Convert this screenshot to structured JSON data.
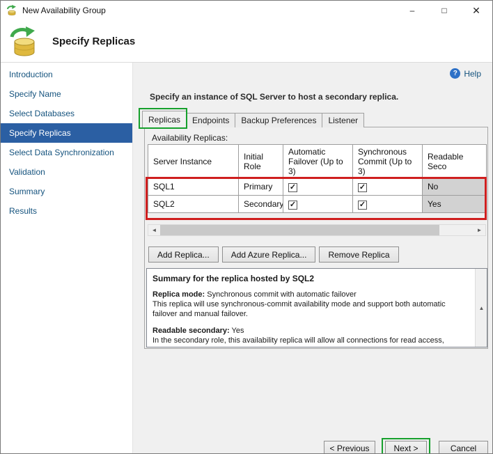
{
  "window": {
    "title": "New Availability Group"
  },
  "icons": {
    "minimize": "–",
    "maximize": "□",
    "close": "✕",
    "help": "?",
    "check": "✓",
    "scroll_left": "◄",
    "scroll_right": "►",
    "scroll_up": "▲",
    "scroll_down": "▼"
  },
  "header": {
    "title": "Specify Replicas"
  },
  "sidebar": {
    "items": [
      {
        "label": "Introduction",
        "selected": false
      },
      {
        "label": "Specify Name",
        "selected": false
      },
      {
        "label": "Select Databases",
        "selected": false
      },
      {
        "label": "Specify Replicas",
        "selected": true
      },
      {
        "label": "Select Data Synchronization",
        "selected": false
      },
      {
        "label": "Validation",
        "selected": false
      },
      {
        "label": "Summary",
        "selected": false
      },
      {
        "label": "Results",
        "selected": false
      }
    ]
  },
  "main": {
    "help_label": "Help",
    "instruction": "Specify an instance of SQL Server to host a secondary replica.",
    "tabs": [
      {
        "label": "Replicas",
        "active": true
      },
      {
        "label": "Endpoints",
        "active": false
      },
      {
        "label": "Backup Preferences",
        "active": false
      },
      {
        "label": "Listener",
        "active": false
      }
    ],
    "availability_label": "Availability Replicas:",
    "table": {
      "columns": [
        "Server Instance",
        "Initial Role",
        "Automatic Failover (Up to 3)",
        "Synchronous Commit (Up to 3)",
        "Readable Seco"
      ],
      "rows": [
        {
          "server": "SQL1",
          "role": "Primary",
          "automatic_failover": true,
          "synchronous_commit": true,
          "readable": "No"
        },
        {
          "server": "SQL2",
          "role": "Secondary",
          "automatic_failover": true,
          "synchronous_commit": true,
          "readable": "Yes"
        }
      ]
    },
    "actions": {
      "add_replica": "Add Replica...",
      "add_azure_replica": "Add Azure Replica...",
      "remove_replica": "Remove Replica"
    },
    "summary": {
      "title": "Summary for the replica hosted by SQL2",
      "mode_label": "Replica mode:",
      "mode_value": " Synchronous commit with automatic failover",
      "mode_desc": "This replica will use synchronous-commit availability mode and support both automatic failover and manual failover.",
      "readable_label": "Readable secondary:",
      "readable_value": " Yes",
      "readable_desc": "In the secondary role, this availability replica will allow all connections for read access, including"
    }
  },
  "footer": {
    "previous": "< Previous",
    "next": "Next >",
    "cancel": "Cancel"
  },
  "colors": {
    "selected_nav_bg": "#2b5fa3",
    "sidebar_link": "#15537e",
    "annotation_red": "#cf1f1f",
    "annotation_green": "#16a02c",
    "readable_cell_bg": "#d2d2d2",
    "help_icon_bg": "#2e71c7"
  }
}
